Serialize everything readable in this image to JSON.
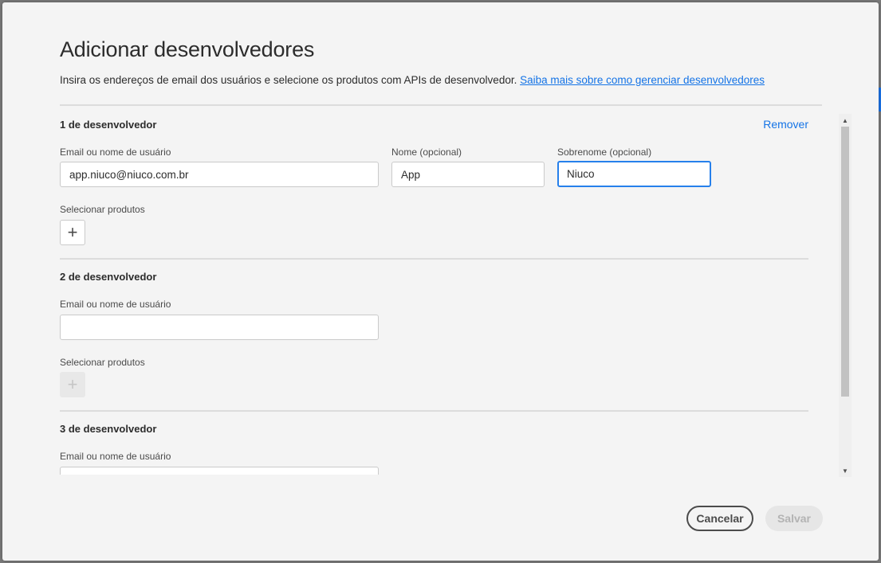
{
  "dialog": {
    "title": "Adicionar desenvolvedores",
    "description": "Insira os endereços de email dos usuários e selecione os produtos com APIs de desenvolvedor. ",
    "learn_more_link": "Saiba mais sobre como gerenciar desenvolvedores"
  },
  "developers": [
    {
      "heading": "1 de desenvolvedor",
      "remove_label": "Remover",
      "email_label": "Email ou nome de usuário",
      "email_value": "app.niuco@niuco.com.br",
      "first_name_label": "Nome (opcional)",
      "first_name_value": "App",
      "last_name_label": "Sobrenome (opcional)",
      "last_name_value": "Niuco",
      "products_label": "Selecionar produtos",
      "add_symbol": "+"
    },
    {
      "heading": "2 de desenvolvedor",
      "email_label": "Email ou nome de usuário",
      "email_value": "",
      "products_label": "Selecionar produtos",
      "add_symbol": "+"
    },
    {
      "heading": "3 de desenvolvedor",
      "email_label": "Email ou nome de usuário",
      "email_value": ""
    }
  ],
  "scrollbar": {
    "up_arrow": "▲",
    "down_arrow": "▼"
  },
  "footer": {
    "cancel_label": "Cancelar",
    "save_label": "Salvar"
  },
  "colors": {
    "link": "#1473e6",
    "focus": "#2680eb",
    "background": "#f4f4f4"
  }
}
